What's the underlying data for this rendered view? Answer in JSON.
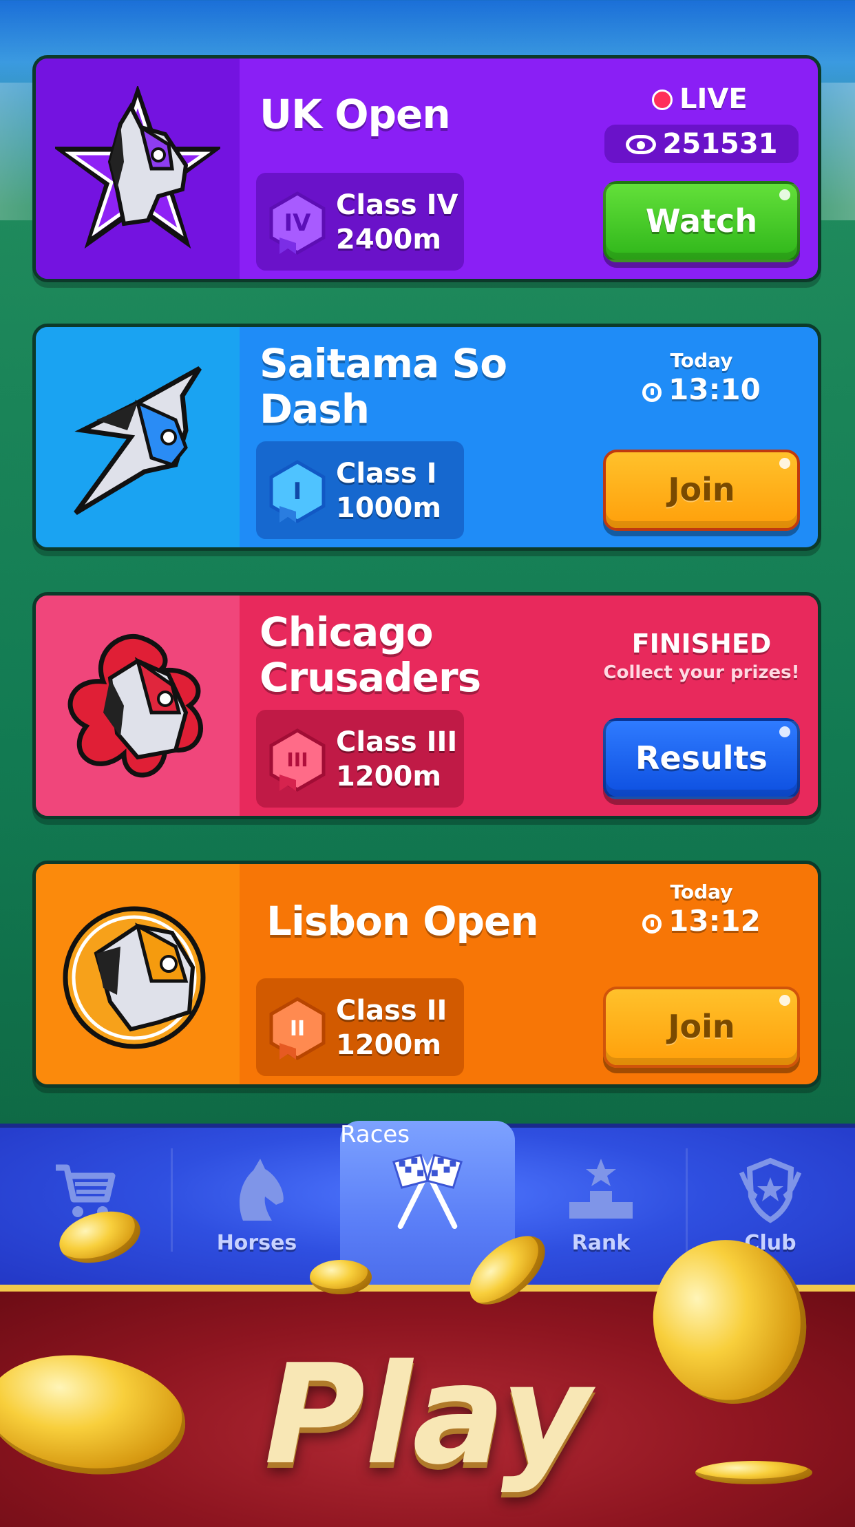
{
  "races": [
    {
      "name": "UK Open",
      "class_roman": "IV",
      "class_label": "Class IV",
      "distance": "2400m",
      "status": "LIVE",
      "viewers": "251531",
      "button": "Watch",
      "colors": {
        "card": "#8a1ff5",
        "logo_zone": "#7413e0",
        "class_box": "#6a12c9",
        "accent": "#a85bff"
      }
    },
    {
      "name": "Saitama So Dash",
      "class_roman": "I",
      "class_label": "Class I",
      "distance": "1000m",
      "time_label": "Today",
      "time": "13:10",
      "button": "Join",
      "colors": {
        "card": "#1f8cf7",
        "logo_zone": "#1aa3f2",
        "class_box": "#1668cf",
        "accent": "#4fc3ff"
      }
    },
    {
      "name": "Chicago Crusaders",
      "class_roman": "III",
      "class_label": "Class III",
      "distance": "1200m",
      "status": "FINISHED",
      "status_sub": "Collect your prizes!",
      "button": "Results",
      "colors": {
        "card": "#e8295c",
        "logo_zone": "#f0467b",
        "class_box": "#c01a46",
        "accent": "#ff6b88"
      }
    },
    {
      "name": "Lisbon Open",
      "class_roman": "II",
      "class_label": "Class II",
      "distance": "1200m",
      "time_label": "Today",
      "time": "13:12",
      "button": "Join",
      "colors": {
        "card": "#f77606",
        "logo_zone": "#fb8a0c",
        "class_box": "#d25a00",
        "accent": "#ff8a50"
      }
    }
  ],
  "nav": {
    "items": [
      {
        "id": "shop",
        "label": "",
        "icon": "cart-icon"
      },
      {
        "id": "horses",
        "label": "Horses",
        "icon": "horse-head-icon"
      },
      {
        "id": "races",
        "label": "Races",
        "icon": "checkered-flags-icon",
        "active": true
      },
      {
        "id": "rank",
        "label": "Rank",
        "icon": "podium-icon"
      },
      {
        "id": "club",
        "label": "Club",
        "icon": "shield-icon"
      }
    ]
  },
  "play_button": "Play"
}
